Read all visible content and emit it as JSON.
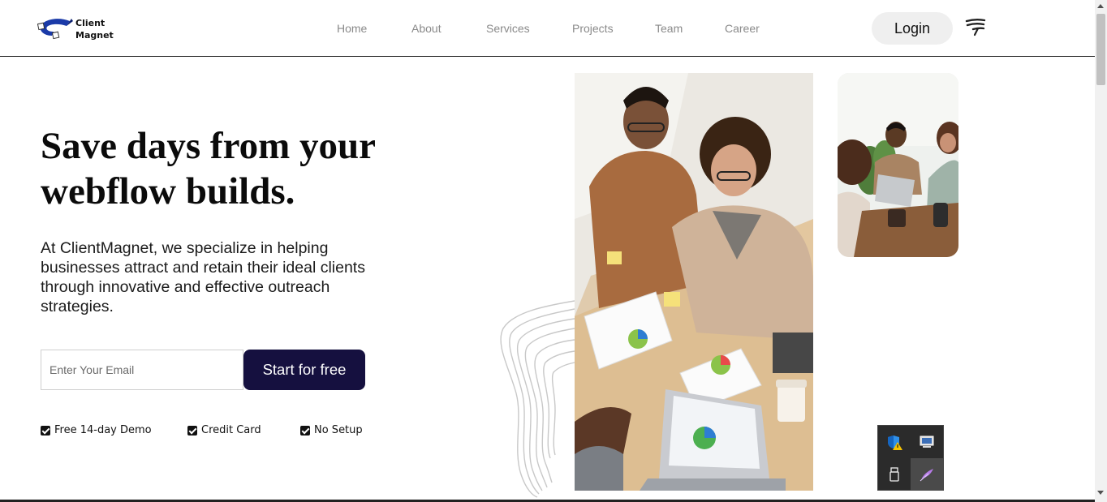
{
  "logo": {
    "line1": "Client",
    "line2": "Magnet"
  },
  "nav": [
    {
      "label": "Home",
      "name": "nav-home"
    },
    {
      "label": "About",
      "name": "nav-about"
    },
    {
      "label": "Services",
      "name": "nav-services"
    },
    {
      "label": "Projects",
      "name": "nav-projects"
    },
    {
      "label": "Team",
      "name": "nav-team"
    },
    {
      "label": "Career",
      "name": "nav-career"
    }
  ],
  "header": {
    "login_label": "Login",
    "menu_icon": "menu-icon"
  },
  "hero": {
    "headline_line1": "Save days from your",
    "headline_line2": "webflow builds.",
    "description": "At ClientMagnet, we specialize in helping businesses attract and retain their ideal clients through innovative and effective outreach strategies.",
    "email_placeholder": "Enter Your Email",
    "cta_label": "Start for free",
    "features": [
      "Free 14-day Demo",
      "Credit Card",
      "No Setup"
    ]
  },
  "images": {
    "main": "team-meeting-photo",
    "secondary": "office-meeting-photo"
  },
  "tray": {
    "icons": [
      "windows-security-warning-icon",
      "display-icon",
      "usb-drive-icon",
      "feather-pen-icon"
    ]
  },
  "colors": {
    "brand_dark": "#15103f",
    "logo_blue": "#1a3aa8",
    "nav_text": "#8a8a8a"
  }
}
